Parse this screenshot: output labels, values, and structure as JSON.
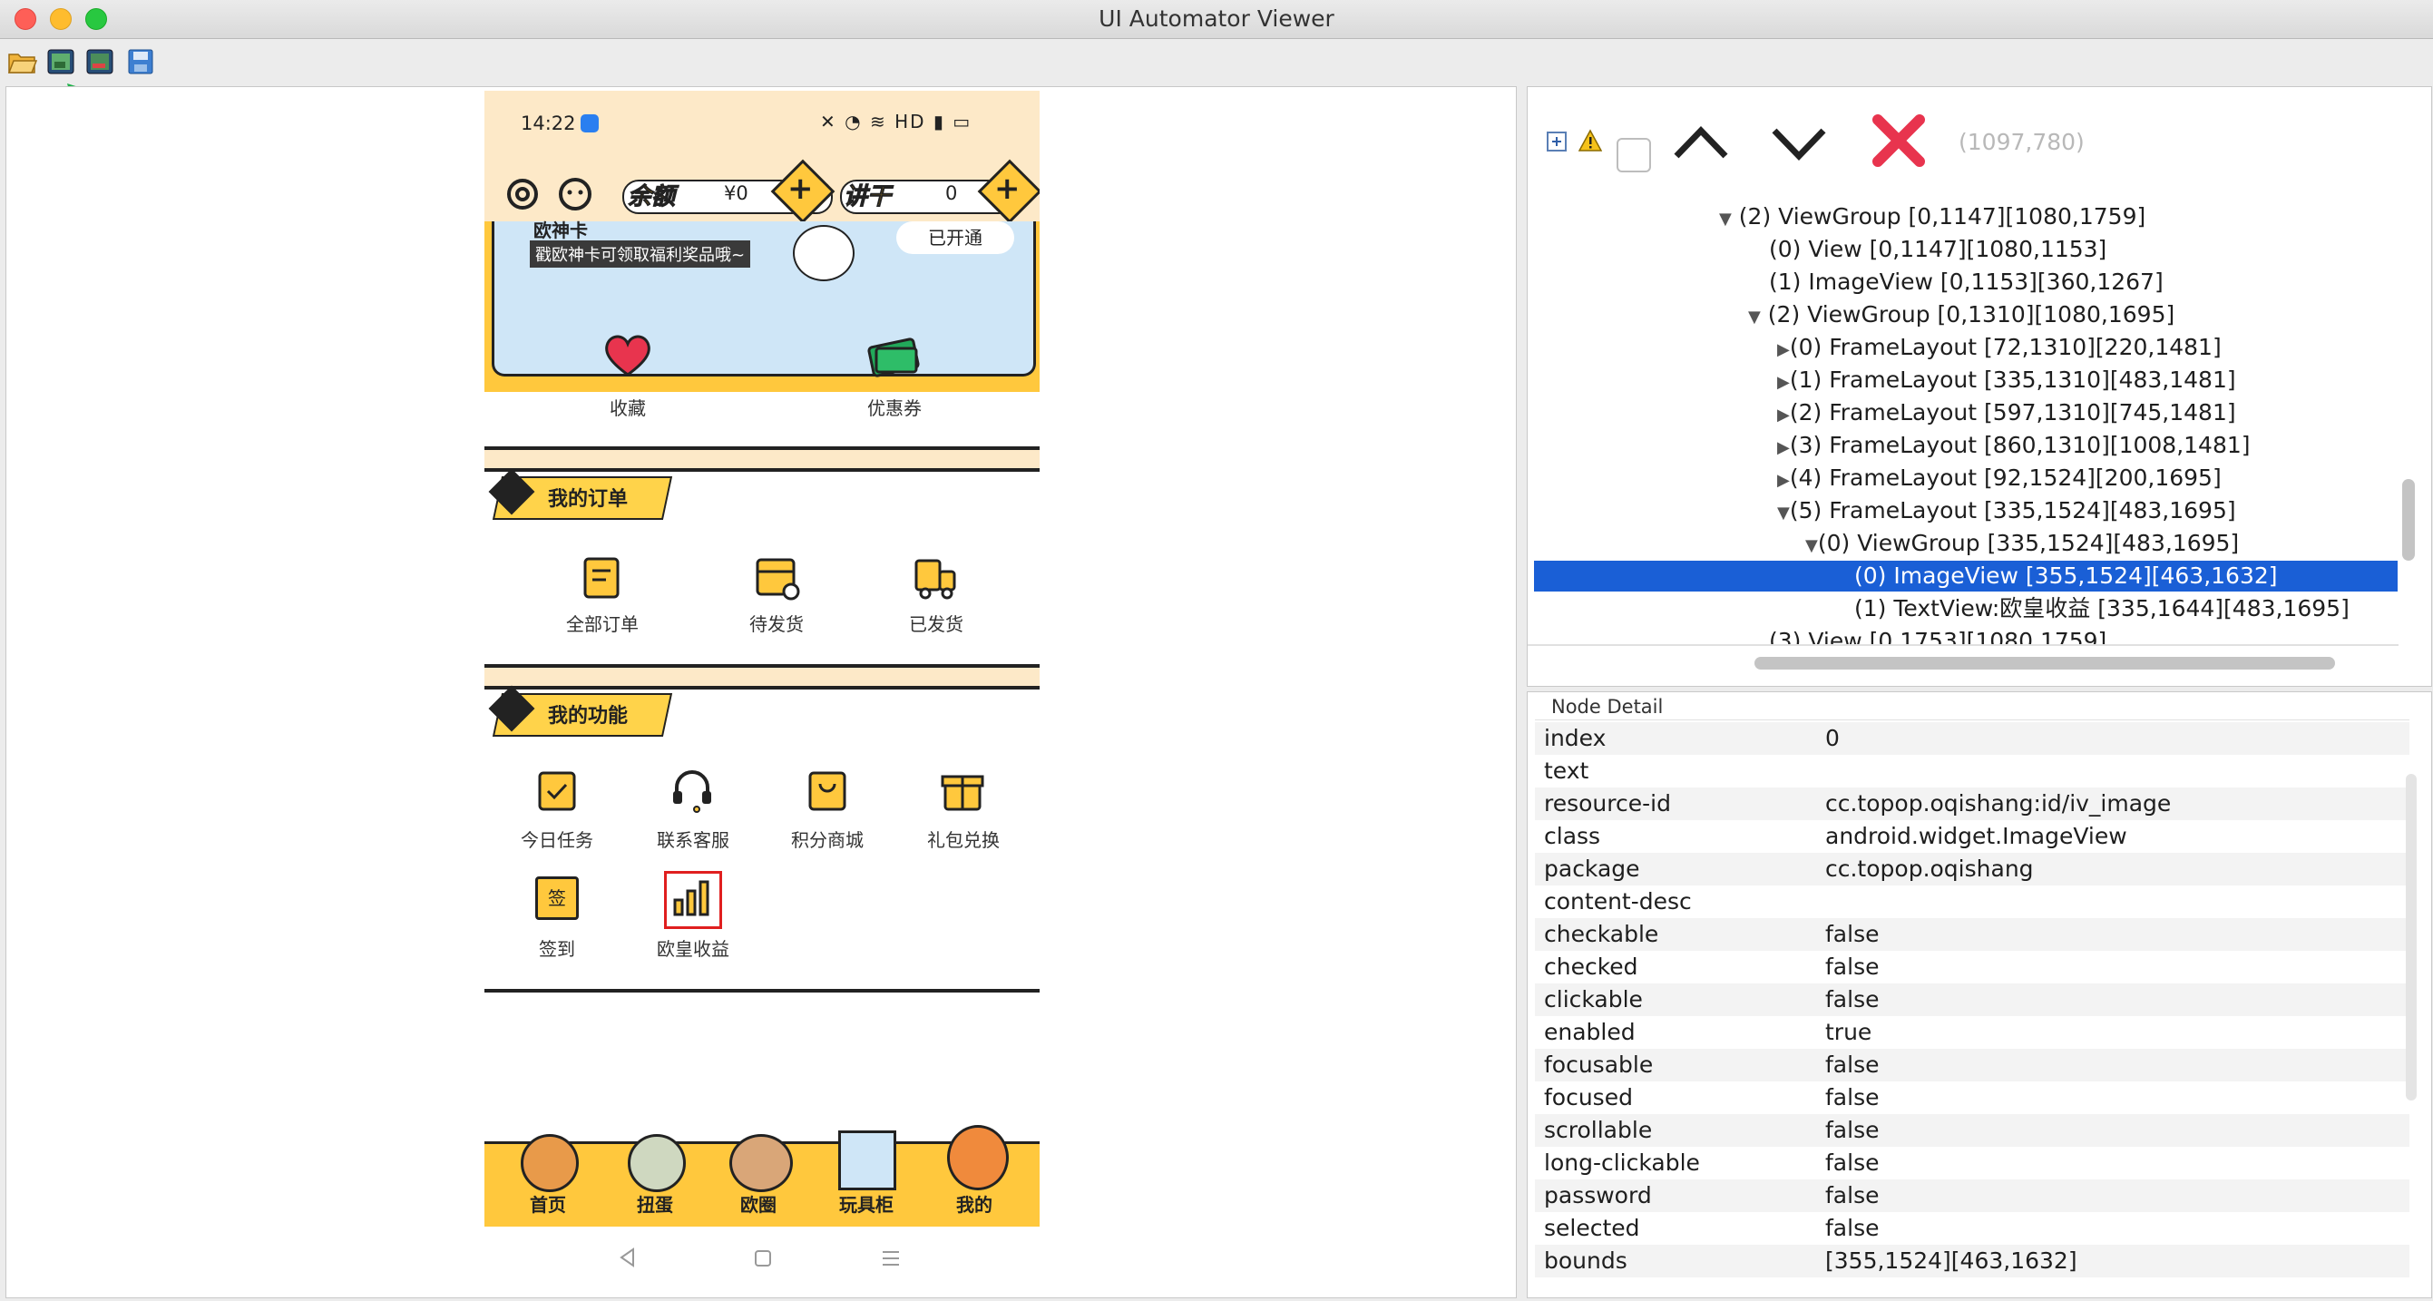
{
  "window": {
    "title": "UI Automator Viewer"
  },
  "toolbar": {
    "icons": [
      "open-folder-icon",
      "device-screenshot-icon",
      "device-screenshot-compressed-icon",
      "save-icon"
    ]
  },
  "phone": {
    "status": {
      "time": "14:22",
      "right": "HD"
    },
    "header": {
      "balance_label": "余额",
      "balance_value": "¥0",
      "coin_label": "讲干",
      "coin_value": "0"
    },
    "banner": {
      "title": "欧神卡",
      "text": "戳欧神卡可领取福利奖品哦~",
      "button": "已开通"
    },
    "quick": [
      {
        "label": "收藏"
      },
      {
        "label": "优惠券"
      }
    ],
    "orders": {
      "title": "我的订单",
      "items": [
        {
          "label": "全部订单"
        },
        {
          "label": "待发货"
        },
        {
          "label": "已发货"
        }
      ]
    },
    "functions": {
      "title": "我的功能",
      "items": [
        {
          "label": "今日任务"
        },
        {
          "label": "联系客服"
        },
        {
          "label": "积分商城"
        },
        {
          "label": "礼包兑换"
        },
        {
          "label": "签到"
        },
        {
          "label": "欧皇收益"
        }
      ]
    },
    "nav": [
      {
        "label": "首页"
      },
      {
        "label": "扭蛋"
      },
      {
        "label": "欧圈"
      },
      {
        "label": "玩具柜"
      },
      {
        "label": "我的"
      }
    ],
    "sign_glyph": "签"
  },
  "tree_toolbar": {
    "coords": "(1097,780)"
  },
  "tree": [
    {
      "text": "(2) ViewGroup [0,1147][1080,1759]",
      "tri": "▼"
    },
    {
      "text": "(0) View [0,1147][1080,1153]",
      "tri": ""
    },
    {
      "text": "(1) ImageView [0,1153][360,1267]",
      "tri": ""
    },
    {
      "text": "(2) ViewGroup [0,1310][1080,1695]",
      "tri": "▼"
    },
    {
      "text": "(0) FrameLayout [72,1310][220,1481]",
      "tri": "▶"
    },
    {
      "text": "(1) FrameLayout [335,1310][483,1481]",
      "tri": "▶"
    },
    {
      "text": "(2) FrameLayout [597,1310][745,1481]",
      "tri": "▶"
    },
    {
      "text": "(3) FrameLayout [860,1310][1008,1481]",
      "tri": "▶"
    },
    {
      "text": "(4) FrameLayout [92,1524][200,1695]",
      "tri": "▶"
    },
    {
      "text": "(5) FrameLayout [335,1524][483,1695]",
      "tri": "▼"
    },
    {
      "text": "(0) ViewGroup [335,1524][483,1695]",
      "tri": "▼"
    },
    {
      "text": "(0) ImageView [355,1524][463,1632]",
      "tri": ""
    },
    {
      "text": "(1) TextView:欧皇收益 [335,1644][483,1695]",
      "tri": ""
    },
    {
      "text": "(3) View [0,1753][1080,1759]",
      "tri": ""
    }
  ],
  "detail": {
    "title": "Node Detail",
    "rows": [
      {
        "key": "index",
        "value": "0"
      },
      {
        "key": "text",
        "value": ""
      },
      {
        "key": "resource-id",
        "value": "cc.topop.oqishang:id/iv_image"
      },
      {
        "key": "class",
        "value": "android.widget.ImageView"
      },
      {
        "key": "package",
        "value": "cc.topop.oqishang"
      },
      {
        "key": "content-desc",
        "value": ""
      },
      {
        "key": "checkable",
        "value": "false"
      },
      {
        "key": "checked",
        "value": "false"
      },
      {
        "key": "clickable",
        "value": "false"
      },
      {
        "key": "enabled",
        "value": "true"
      },
      {
        "key": "focusable",
        "value": "false"
      },
      {
        "key": "focused",
        "value": "false"
      },
      {
        "key": "scrollable",
        "value": "false"
      },
      {
        "key": "long-clickable",
        "value": "false"
      },
      {
        "key": "password",
        "value": "false"
      },
      {
        "key": "selected",
        "value": "false"
      },
      {
        "key": "bounds",
        "value": "[355,1524][463,1632]"
      }
    ]
  },
  "colors": {
    "accent_yellow": "#ffc83d",
    "selection_blue": "#1a5fd6",
    "arrow_green": "#1fb24a",
    "close_red": "#e8344e"
  }
}
